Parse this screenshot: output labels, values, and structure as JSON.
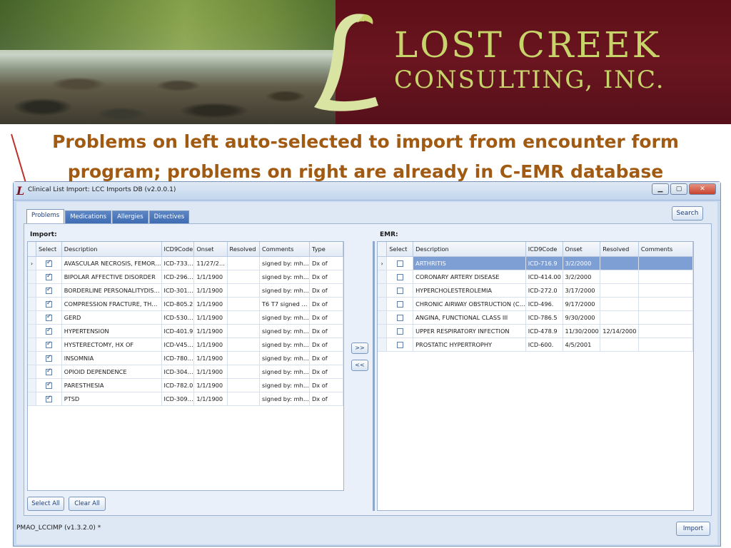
{
  "banner": {
    "brand_line1": "LOST CREEK",
    "brand_line2": "CONSULTING, INC.",
    "colors": {
      "maroon": "#6a1520",
      "brand_text": "#c7d46a"
    }
  },
  "caption": {
    "line1": "Problems on left auto-selected to import from encounter form",
    "line2": "program; problems on right are already in C-EMR database"
  },
  "window": {
    "title": "Clinical List Import: LCC Imports DB  (v2.0.0.1)",
    "icon": "lcc-logo-icon"
  },
  "tabs": [
    {
      "label": "Problems",
      "active": true
    },
    {
      "label": "Medications",
      "active": false
    },
    {
      "label": "Allergies",
      "active": false
    },
    {
      "label": "Directives",
      "active": false
    }
  ],
  "search_label": "Search",
  "import_panel": {
    "label": "Import:",
    "columns": [
      "Select",
      "Description",
      "ICD9Code",
      "Onset",
      "Resolved",
      "Comments",
      "Type"
    ],
    "rows": [
      {
        "marker": "›",
        "selected": true,
        "description": "AVASCULAR NECROSIS, FEMOR…",
        "icd9": "ICD-733…",
        "onset": "11/27/2…",
        "resolved": "",
        "comments": "signed by: mh…",
        "type": "Dx of"
      },
      {
        "marker": "",
        "selected": true,
        "description": "BIPOLAR AFFECTIVE DISORDER",
        "icd9": "ICD-296…",
        "onset": "1/1/1900",
        "resolved": "",
        "comments": "signed by: mh…",
        "type": "Dx of"
      },
      {
        "marker": "",
        "selected": true,
        "description": "BORDERLINE PERSONALITYDIS…",
        "icd9": "ICD-301…",
        "onset": "1/1/1900",
        "resolved": "",
        "comments": "signed by: mh…",
        "type": "Dx of"
      },
      {
        "marker": "",
        "selected": true,
        "description": "COMPRESSION FRACTURE, TH…",
        "icd9": "ICD-805.2",
        "onset": "1/1/1900",
        "resolved": "",
        "comments": "T6 T7  signed …",
        "type": "Dx of"
      },
      {
        "marker": "",
        "selected": true,
        "description": "GERD",
        "icd9": "ICD-530…",
        "onset": "1/1/1900",
        "resolved": "",
        "comments": "signed by: mh…",
        "type": "Dx of"
      },
      {
        "marker": "",
        "selected": true,
        "description": "HYPERTENSION",
        "icd9": "ICD-401.9",
        "onset": "1/1/1900",
        "resolved": "",
        "comments": "signed by: mh…",
        "type": "Dx of"
      },
      {
        "marker": "",
        "selected": true,
        "description": "HYSTERECTOMY, HX OF",
        "icd9": "ICD-V45…",
        "onset": "1/1/1900",
        "resolved": "",
        "comments": "signed by: mh…",
        "type": "Dx of"
      },
      {
        "marker": "",
        "selected": true,
        "description": "INSOMNIA",
        "icd9": "ICD-780…",
        "onset": "1/1/1900",
        "resolved": "",
        "comments": "signed by: mh…",
        "type": "Dx of"
      },
      {
        "marker": "",
        "selected": true,
        "description": "OPIOID DEPENDENCE",
        "icd9": "ICD-304…",
        "onset": "1/1/1900",
        "resolved": "",
        "comments": "signed by: mh…",
        "type": "Dx of"
      },
      {
        "marker": "",
        "selected": true,
        "description": "PARESTHESIA",
        "icd9": "ICD-782.0",
        "onset": "1/1/1900",
        "resolved": "",
        "comments": "signed by: mh…",
        "type": "Dx of"
      },
      {
        "marker": "",
        "selected": true,
        "description": "PTSD",
        "icd9": "ICD-309…",
        "onset": "1/1/1900",
        "resolved": "",
        "comments": "signed by: mh…",
        "type": "Dx of"
      }
    ],
    "select_all_label": "Select All",
    "clear_all_label": "Clear All"
  },
  "move_right_label": ">>",
  "move_left_label": "<<",
  "emr_panel": {
    "label": "EMR:",
    "columns": [
      "Select",
      "Description",
      "ICD9Code",
      "Onset",
      "Resolved",
      "Comments"
    ],
    "rows": [
      {
        "marker": "›",
        "selected": false,
        "highlight": true,
        "description": "ARTHRITIS",
        "icd9": "ICD-716.9",
        "onset": "3/2/2000",
        "resolved": "",
        "comments": ""
      },
      {
        "marker": "",
        "selected": false,
        "highlight": false,
        "description": "CORONARY ARTERY DISEASE",
        "icd9": "ICD-414.00",
        "onset": "3/2/2000",
        "resolved": "",
        "comments": ""
      },
      {
        "marker": "",
        "selected": false,
        "highlight": false,
        "description": "HYPERCHOLESTEROLEMIA",
        "icd9": "ICD-272.0",
        "onset": "3/17/2000",
        "resolved": "",
        "comments": ""
      },
      {
        "marker": "",
        "selected": false,
        "highlight": false,
        "description": "CHRONIC AIRWAY OBSTRUCTION (C…",
        "icd9": "ICD-496.",
        "onset": "9/17/2000",
        "resolved": "",
        "comments": ""
      },
      {
        "marker": "",
        "selected": false,
        "highlight": false,
        "description": "ANGINA, FUNCTIONAL CLASS III",
        "icd9": "ICD-786.5",
        "onset": "9/30/2000",
        "resolved": "",
        "comments": ""
      },
      {
        "marker": "",
        "selected": false,
        "highlight": false,
        "description": "UPPER RESPIRATORY INFECTION",
        "icd9": "ICD-478.9",
        "onset": "11/30/2000",
        "resolved": "12/14/2000",
        "comments": ""
      },
      {
        "marker": "",
        "selected": false,
        "highlight": false,
        "description": "PROSTATIC HYPERTROPHY",
        "icd9": "ICD-600.",
        "onset": "4/5/2001",
        "resolved": "",
        "comments": ""
      }
    ]
  },
  "status_text": "PMAO_LCCIMP (v1.3.2.0) *",
  "import_button_label": "Import"
}
